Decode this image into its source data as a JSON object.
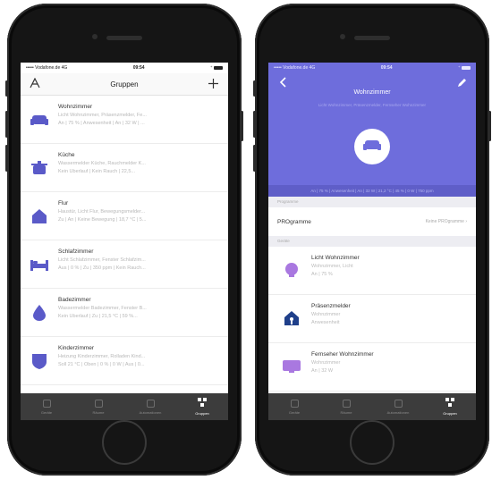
{
  "left_screen": {
    "status": {
      "carrier": "••••• Vodafone.de  4G",
      "time": "09:54",
      "battery_hint": "⁺"
    },
    "nav": {
      "title": "Gruppen",
      "left_icon": "logo-icon",
      "right_icon": "plus-icon"
    },
    "groups": [
      {
        "name": "Wohnzimmer",
        "line1": "Licht Wohnzimmer, Präsenzmelder, Fe...",
        "line2": "An | 75 % | Anwesenheit | An | 32 W | ...",
        "icon": "sofa-icon"
      },
      {
        "name": "Küche",
        "line1": "Wassermelder Küche, Rauchmelder K...",
        "line2": "Kein Überlauf | Kein Rauch | 22,5...",
        "icon": "pot-icon"
      },
      {
        "name": "Flur",
        "line1": "Haustür, Licht Flur, Bewegungsmelder...",
        "line2": "Zu | An | Keine Bewegung | 18,7 °C | 5...",
        "icon": "house-icon"
      },
      {
        "name": "Schlafzimmer",
        "line1": "Licht Schlafzimmer, Fenster Schlafzim...",
        "line2": "Aus | 0 % | Zu | 350 ppm | Kein Rauch...",
        "icon": "bed-icon"
      },
      {
        "name": "Badezimmer",
        "line1": "Wassermelder Badezimmer, Fenster B...",
        "line2": "Kein Überlauf | Zu | 21,5 °C | 59 %...",
        "icon": "drop-icon"
      },
      {
        "name": "Kinderzimmer",
        "line1": "Heizung Kinderzimmer, Rolladen Kind...",
        "line2": "Soll 21 °C | Oben | 0 % | 0 W | Aus | 0...",
        "icon": "shield-icon"
      }
    ],
    "tabs": [
      {
        "label": "Geräte",
        "active": false
      },
      {
        "label": "Räume",
        "active": false
      },
      {
        "label": "Automationen",
        "active": false
      },
      {
        "label": "Gruppen",
        "active": true
      }
    ]
  },
  "right_screen": {
    "status": {
      "carrier": "••••• Vodafone.de  4G",
      "time": "09:54",
      "battery_hint": "⁺"
    },
    "title": "Wohnzimmer",
    "subtitle": "Licht Wohnzimmer, Präsenzmelder, Fernseher Wohnzimmer",
    "info_bar": "An | 75 % | Anwesenheit | An | 32 W | 21,2 °C | 45 % | 0 W | 750 ppm",
    "section_programs": "Programme",
    "programs_label": "PROgramme",
    "programs_value": "Keine PROgramme",
    "section_devices": "Geräte",
    "devices": [
      {
        "name": "Licht Wohnzimmer",
        "line1": "Wohnzimmer, Licht",
        "line2": "An | 75 %",
        "icon": "bulb-icon"
      },
      {
        "name": "Präsenzmelder",
        "line1": "Wohnzimmer",
        "line2": "Anwesenheit",
        "icon": "house-presence-icon"
      },
      {
        "name": "Fernseher Wohnzimmer",
        "line1": "Wohnzimmer",
        "line2": "An | 32 W",
        "icon": "tv-icon"
      }
    ],
    "tabs": [
      {
        "label": "Geräte",
        "active": false
      },
      {
        "label": "Räume",
        "active": false
      },
      {
        "label": "Automationen",
        "active": false
      },
      {
        "label": "Gruppen",
        "active": true
      }
    ]
  },
  "colors": {
    "accent": "#6e6ddc",
    "icon": "#5a5ac8",
    "tabbar": "#3c3c3c"
  }
}
